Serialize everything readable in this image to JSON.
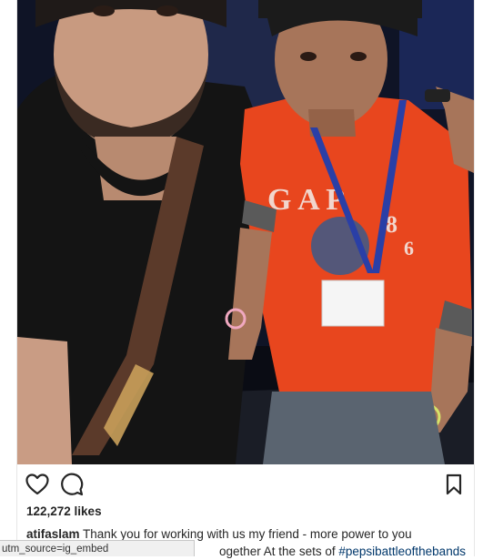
{
  "post": {
    "likes_text": "122,272 likes",
    "username": "atifaslam",
    "caption_line1": "Thank you for working with us my friend - more power to you",
    "caption_line2_visible": "ogether At the sets of ",
    "hashtag": "#pepsibattleofthebands"
  },
  "icons": {
    "like": "heart-icon",
    "comment": "comment-icon",
    "save": "bookmark-icon"
  },
  "status_bar": {
    "url_text": "utm_source=ig_embed"
  },
  "colors": {
    "text": "#262626",
    "hashtag": "#00376b",
    "shirt_orange": "#e8461e",
    "lanyard_blue": "#2a3fa6"
  }
}
